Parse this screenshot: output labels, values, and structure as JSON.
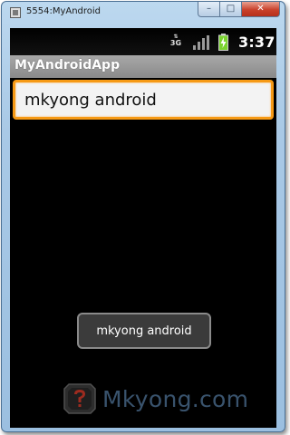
{
  "window": {
    "title": "5554:MyAndroid",
    "minimize_glyph": "–",
    "maximize_glyph": "□",
    "close_glyph": "✕"
  },
  "status_bar": {
    "network_type": "3G",
    "time": "3:37",
    "battery_state": "charging"
  },
  "action_bar": {
    "title": "MyAndroidApp"
  },
  "edit_text": {
    "value": "mkyong android"
  },
  "toast": {
    "message": "mkyong android"
  },
  "watermark": {
    "text": "Mkyong.com"
  },
  "colors": {
    "focus_border": "#f69a16",
    "screen_bg": "#000000",
    "action_bar_bg": "#9a9a9a",
    "battery_green": "#7bd430",
    "close_button": "#c9412b"
  }
}
